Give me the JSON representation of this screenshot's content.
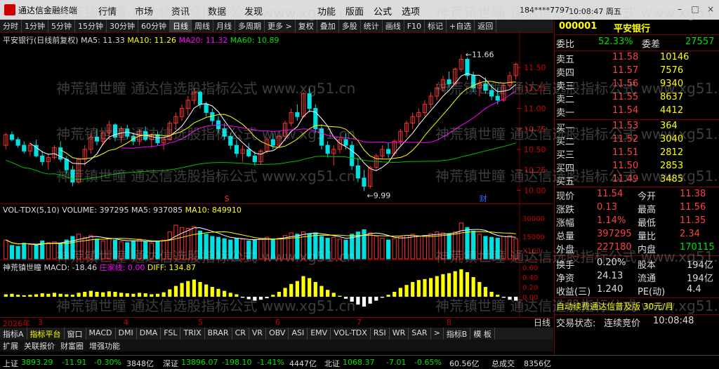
{
  "app": {
    "title": "通达信金融终端",
    "user": "184****7797",
    "clock": "10:08:47 周五"
  },
  "menu": [
    "行情",
    "市场",
    "资讯",
    "数据",
    "发现"
  ],
  "menu2": [
    "功能",
    "版面",
    "公式",
    "选项"
  ],
  "window_buttons": [
    "–",
    "□",
    "×"
  ],
  "toolbar": [
    "分时",
    "1分钟",
    "5分钟",
    "15分钟",
    "30分钟",
    "60分钟",
    "日线",
    "周线",
    "月线",
    "多周期",
    "更多 >",
    "复权",
    "叠加",
    "多股",
    "统计",
    "画线",
    "F10",
    "标记",
    "+自选",
    "返回"
  ],
  "toolbar_active": "日线",
  "main_legend": {
    "name": "平安银行(日线前复权)",
    "ma5": "MA5: 11.33",
    "ma10": "MA10: 11.26",
    "ma20": "MA20: 11.32",
    "ma60": "MA60: 10.89"
  },
  "price_axis": [
    "11.50",
    "11.25",
    "11.00",
    "10.75",
    "10.50",
    "10.25",
    "10.00"
  ],
  "annotations": {
    "high": "11.66",
    "low": "9.99",
    "s_mark": "S",
    "cai_mark": "财"
  },
  "vol_legend": {
    "name": "VOL-TDX(5,10)",
    "vol": "VOLUME: 397295",
    "ma5": "MA5: 937085",
    "ma10": "MA10: 849910"
  },
  "vol_axis": [
    "30000",
    "15000",
    "X100"
  ],
  "macd_legend": {
    "name": "神荒镇世瞳",
    "macd": "MACD: -18.46",
    "x1": "庄家线: 0.00",
    "x2": "DIFF: 134.87"
  },
  "macd_axis": [
    "0.60",
    "0.40",
    "0.20",
    "0.00"
  ],
  "date_axis": [
    "2026年",
    "3",
    "4",
    "5",
    "6",
    "7",
    "8"
  ],
  "panel_tabs": [
    "指标A",
    "指标平台",
    "窗口",
    "MACD",
    "DMI",
    "DMA",
    "FSL",
    "TRIX",
    "BRAR",
    "CR",
    "VR",
    "OBV",
    "ASI",
    "EMV",
    "VOL-TDX",
    "RSI",
    "WR",
    "SAR",
    ">",
    "指标B",
    "模 板"
  ],
  "ext_tabs": [
    "扩展",
    "关联报价",
    "财富圈",
    "增强功能"
  ],
  "right": {
    "code": "000001",
    "name": "平安银行",
    "weibi_label": "委比",
    "weibi": "52.33%",
    "weicha_label": "委差",
    "weicha": "27557",
    "asks": [
      {
        "label": "卖五",
        "price": "11.58",
        "vol": "10146"
      },
      {
        "label": "卖四",
        "price": "11.57",
        "vol": "7576"
      },
      {
        "label": "卖三",
        "price": "11.56",
        "vol": "9340"
      },
      {
        "label": "卖二",
        "price": "11.55",
        "vol": "8637"
      },
      {
        "label": "卖一",
        "price": "11.54",
        "vol": "4412"
      }
    ],
    "bids": [
      {
        "label": "买一",
        "price": "11.53",
        "vol": "364"
      },
      {
        "label": "买二",
        "price": "11.52",
        "vol": "3040"
      },
      {
        "label": "买三",
        "price": "11.51",
        "vol": "2812"
      },
      {
        "label": "买四",
        "price": "11.50",
        "vol": "2853"
      },
      {
        "label": "买五",
        "price": "11.49",
        "vol": "3485"
      }
    ],
    "stats": [
      {
        "l1": "现价",
        "v1": "11.54",
        "l2": "今开",
        "v2": "11.38"
      },
      {
        "l1": "涨跌",
        "v1": "0.13",
        "l2": "最高",
        "v2": "11.56"
      },
      {
        "l1": "涨幅",
        "v1": "1.14%",
        "l2": "最低",
        "v2": "11.35"
      },
      {
        "l1": "总量",
        "v1": "397295",
        "l2": "量比",
        "v2": "2.34"
      },
      {
        "l1": "外盘",
        "v1": "227180",
        "l2": "内盘",
        "v2": "170115"
      }
    ],
    "fund": [
      {
        "l1": "换手",
        "v1": "0.20%",
        "l2": "股本",
        "v2": "194亿"
      },
      {
        "l1": "净资",
        "v1": "24.13",
        "l2": "流通",
        "v2": "194亿"
      },
      {
        "l1": "收益(三)",
        "v1": "1.240",
        "l2": "PE(动)",
        "v2": "4.4"
      }
    ],
    "promo": "自动续费通达信普及版 30元/月",
    "tab": "日线",
    "trade_state_label": "交易状态:",
    "trade_state": "连续竞价",
    "trade_time": "10:08:48"
  },
  "status": {
    "sh_label": "上证",
    "sh": "3893.29",
    "sh_chg": "-11.91",
    "sh_pct": "-0.30%",
    "sh_amt": "3848亿",
    "sz_label": "深证",
    "sz": "13896.07",
    "sz_chg": "-198.10",
    "sz_pct": "-1.41%",
    "sz_amt": "4447亿",
    "bz_label": "北证",
    "bz": "1068.37",
    "bz_chg": "-7.01",
    "bz_pct": "-0.65%",
    "bz_amt": "60.56亿",
    "total_label": "总成交",
    "total": "8356亿"
  },
  "watermark": "神荒镇世瞳 通达信选股指标公式 www.xg51.cn",
  "chart_data": {
    "type": "candlestick",
    "ylim": [
      9.9,
      11.75
    ],
    "ma_colors": {
      "ma5": "#ffffff",
      "ma10": "#ffff00",
      "ma20": "#ff00ff",
      "ma60": "#00c000"
    },
    "ohlc": [
      [
        10.55,
        10.7,
        10.5,
        10.68
      ],
      [
        10.68,
        10.72,
        10.6,
        10.62
      ],
      [
        10.62,
        10.65,
        10.52,
        10.55
      ],
      [
        10.55,
        10.6,
        10.45,
        10.48
      ],
      [
        10.48,
        10.58,
        10.42,
        10.55
      ],
      [
        10.55,
        10.62,
        10.4,
        10.42
      ],
      [
        10.42,
        10.48,
        10.3,
        10.35
      ],
      [
        10.35,
        10.45,
        10.25,
        10.4
      ],
      [
        10.4,
        10.55,
        10.38,
        10.52
      ],
      [
        10.52,
        10.6,
        10.35,
        10.38
      ],
      [
        10.38,
        10.42,
        10.2,
        10.25
      ],
      [
        10.25,
        10.3,
        10.05,
        10.1
      ],
      [
        10.1,
        10.4,
        10.08,
        10.38
      ],
      [
        10.38,
        10.55,
        10.3,
        10.5
      ],
      [
        10.5,
        10.7,
        10.45,
        10.65
      ],
      [
        10.65,
        10.75,
        10.55,
        10.6
      ],
      [
        10.6,
        10.72,
        10.55,
        10.7
      ],
      [
        10.7,
        10.85,
        10.62,
        10.8
      ],
      [
        10.8,
        10.82,
        10.6,
        10.65
      ],
      [
        10.65,
        10.78,
        10.58,
        10.75
      ],
      [
        10.75,
        10.8,
        10.62,
        10.66
      ],
      [
        10.66,
        10.7,
        10.55,
        10.6
      ],
      [
        10.6,
        10.75,
        10.55,
        10.72
      ],
      [
        10.72,
        10.78,
        10.6,
        10.62
      ],
      [
        10.62,
        10.7,
        10.52,
        10.68
      ],
      [
        10.68,
        10.72,
        10.55,
        10.58
      ],
      [
        10.58,
        10.65,
        10.5,
        10.62
      ],
      [
        10.62,
        10.85,
        10.6,
        10.82
      ],
      [
        10.82,
        10.95,
        10.75,
        10.9
      ],
      [
        10.9,
        11.05,
        10.85,
        11.0
      ],
      [
        11.0,
        11.15,
        10.92,
        11.1
      ],
      [
        11.1,
        11.25,
        11.05,
        11.2
      ],
      [
        11.2,
        11.22,
        11.0,
        11.05
      ],
      [
        11.05,
        11.08,
        10.9,
        10.95
      ],
      [
        10.95,
        11.0,
        10.8,
        10.85
      ],
      [
        10.85,
        10.9,
        10.7,
        10.75
      ],
      [
        10.75,
        10.82,
        10.62,
        10.66
      ],
      [
        10.66,
        10.7,
        10.5,
        10.55
      ],
      [
        10.55,
        10.62,
        10.4,
        10.45
      ],
      [
        10.45,
        10.55,
        10.35,
        10.5
      ],
      [
        10.5,
        10.58,
        10.4,
        10.42
      ],
      [
        10.42,
        10.48,
        10.3,
        10.35
      ],
      [
        10.35,
        10.5,
        10.32,
        10.48
      ],
      [
        10.48,
        10.65,
        10.45,
        10.62
      ],
      [
        10.62,
        10.7,
        10.5,
        10.55
      ],
      [
        10.55,
        10.68,
        10.52,
        10.66
      ],
      [
        10.66,
        10.85,
        10.6,
        10.82
      ],
      [
        10.82,
        11.0,
        10.78,
        10.95
      ],
      [
        10.95,
        11.05,
        10.85,
        10.9
      ],
      [
        10.9,
        11.2,
        10.88,
        11.18
      ],
      [
        11.18,
        11.25,
        10.95,
        11.0
      ],
      [
        11.0,
        11.05,
        10.7,
        10.75
      ],
      [
        10.75,
        10.8,
        10.5,
        10.55
      ],
      [
        10.55,
        10.6,
        10.4,
        10.45
      ],
      [
        10.45,
        10.55,
        10.3,
        10.5
      ],
      [
        10.5,
        10.65,
        10.45,
        10.62
      ],
      [
        10.62,
        10.7,
        10.5,
        10.55
      ],
      [
        10.55,
        10.6,
        10.25,
        10.3
      ],
      [
        10.3,
        10.4,
        10.1,
        10.15
      ],
      [
        10.15,
        10.25,
        9.99,
        10.05
      ],
      [
        10.05,
        10.3,
        10.02,
        10.28
      ],
      [
        10.28,
        10.45,
        10.25,
        10.42
      ],
      [
        10.42,
        10.55,
        10.38,
        10.5
      ],
      [
        10.5,
        10.58,
        10.4,
        10.45
      ],
      [
        10.45,
        10.62,
        10.42,
        10.6
      ],
      [
        10.6,
        10.75,
        10.55,
        10.72
      ],
      [
        10.72,
        10.85,
        10.65,
        10.82
      ],
      [
        10.82,
        10.95,
        10.75,
        10.9
      ],
      [
        10.9,
        11.0,
        10.8,
        10.95
      ],
      [
        10.95,
        11.1,
        10.9,
        11.05
      ],
      [
        11.05,
        11.2,
        11.0,
        11.15
      ],
      [
        11.15,
        11.3,
        11.1,
        11.25
      ],
      [
        11.25,
        11.4,
        11.2,
        11.35
      ],
      [
        11.35,
        11.45,
        11.25,
        11.3
      ],
      [
        11.3,
        11.5,
        11.28,
        11.48
      ],
      [
        11.48,
        11.66,
        11.45,
        11.6
      ],
      [
        11.6,
        11.62,
        11.35,
        11.4
      ],
      [
        11.4,
        11.45,
        11.2,
        11.25
      ],
      [
        11.25,
        11.35,
        11.15,
        11.3
      ],
      [
        11.3,
        11.38,
        11.18,
        11.22
      ],
      [
        11.22,
        11.3,
        11.1,
        11.15
      ],
      [
        11.15,
        11.25,
        11.05,
        11.1
      ],
      [
        11.1,
        11.3,
        11.08,
        11.28
      ],
      [
        11.28,
        11.45,
        11.25,
        11.4
      ],
      [
        11.4,
        11.56,
        11.35,
        11.54
      ]
    ],
    "volume": [
      0.42,
      0.3,
      0.28,
      0.35,
      0.32,
      0.3,
      0.4,
      0.36,
      0.38,
      0.33,
      0.42,
      0.5,
      0.55,
      0.48,
      0.52,
      0.44,
      0.4,
      0.46,
      0.42,
      0.38,
      0.36,
      0.4,
      0.44,
      0.38,
      0.35,
      0.4,
      0.42,
      0.6,
      0.75,
      0.7,
      0.68,
      0.72,
      0.62,
      0.55,
      0.5,
      0.48,
      0.45,
      0.42,
      0.46,
      0.44,
      0.4,
      0.42,
      0.45,
      0.48,
      0.44,
      0.46,
      0.52,
      0.58,
      0.55,
      0.6,
      0.56,
      0.58,
      0.5,
      0.46,
      0.48,
      0.44,
      0.42,
      0.55,
      0.6,
      0.65,
      0.58,
      0.5,
      0.46,
      0.42,
      0.45,
      0.5,
      0.52,
      0.55,
      0.5,
      0.52,
      0.56,
      0.6,
      0.58,
      0.55,
      0.6,
      0.8,
      0.7,
      0.62,
      0.55,
      0.5,
      0.48,
      0.46,
      0.5,
      0.52,
      0.45
    ],
    "macd": [
      0.05,
      0.06,
      0.04,
      0.03,
      0.04,
      0.05,
      0.07,
      0.06,
      0.08,
      0.06,
      0.05,
      0.04,
      0.08,
      0.1,
      0.12,
      0.1,
      0.09,
      0.11,
      0.1,
      0.08,
      0.07,
      0.06,
      0.08,
      0.07,
      0.05,
      0.06,
      0.09,
      0.15,
      0.22,
      0.28,
      0.32,
      0.35,
      0.3,
      0.25,
      0.2,
      0.16,
      0.12,
      0.08,
      0.05,
      -0.02,
      -0.05,
      -0.08,
      -0.06,
      -0.03,
      0.04,
      0.1,
      0.18,
      0.26,
      0.32,
      0.42,
      0.38,
      0.3,
      0.22,
      0.14,
      0.08,
      0.02,
      -0.04,
      -0.1,
      -0.16,
      -0.2,
      -0.14,
      -0.08,
      -0.02,
      0.04,
      0.1,
      0.18,
      0.24,
      0.3,
      0.34,
      0.36,
      0.38,
      0.42,
      0.46,
      0.48,
      0.52,
      0.56,
      0.5,
      0.4,
      0.3,
      0.2,
      0.1,
      0.04,
      -0.02,
      -0.06,
      -0.08
    ]
  }
}
